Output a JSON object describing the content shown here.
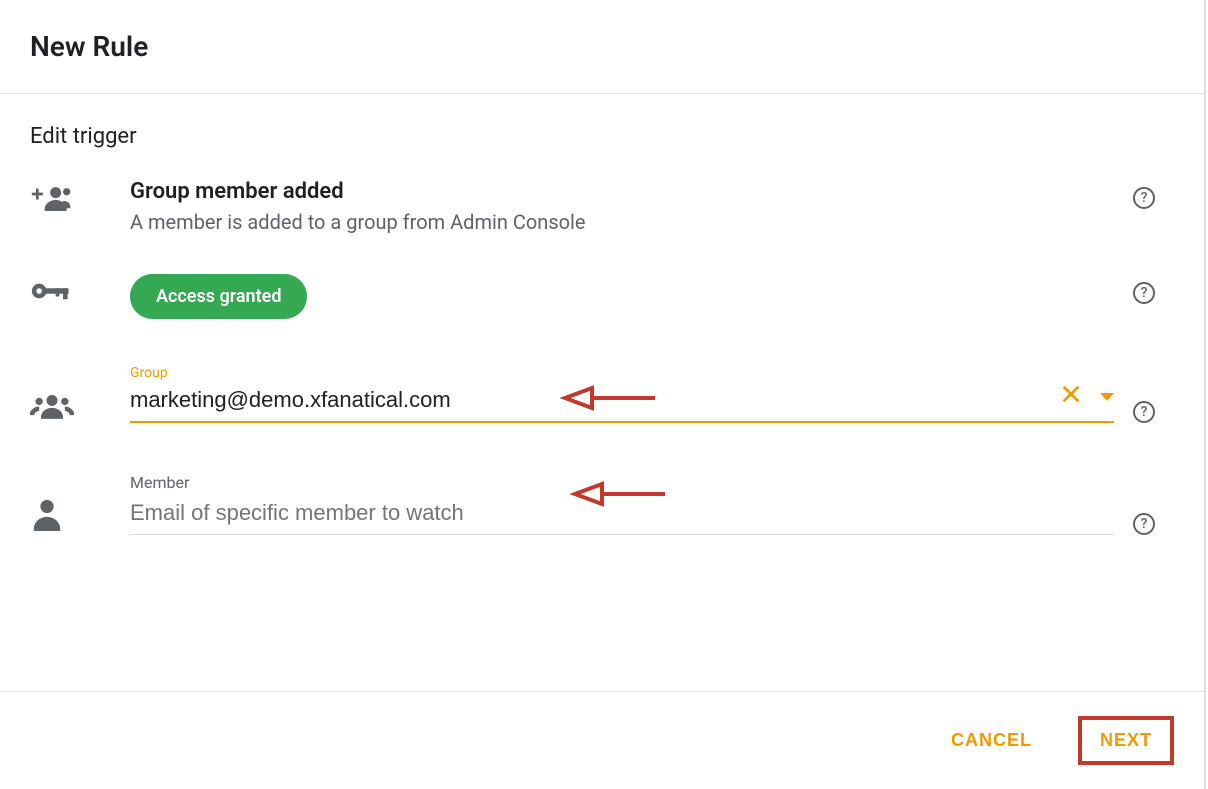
{
  "page_title": "New Rule",
  "section_title": "Edit trigger",
  "trigger": {
    "title": "Group member added",
    "description": "A member is added to a group from Admin Console"
  },
  "access": {
    "status_label": "Access granted"
  },
  "group_field": {
    "label": "Group",
    "value": "marketing@demo.xfanatical.com"
  },
  "member_field": {
    "label": "Member",
    "placeholder": "Email of specific member to watch",
    "value": ""
  },
  "footer": {
    "cancel_label": "CANCEL",
    "next_label": "NEXT"
  },
  "help_char": "?"
}
